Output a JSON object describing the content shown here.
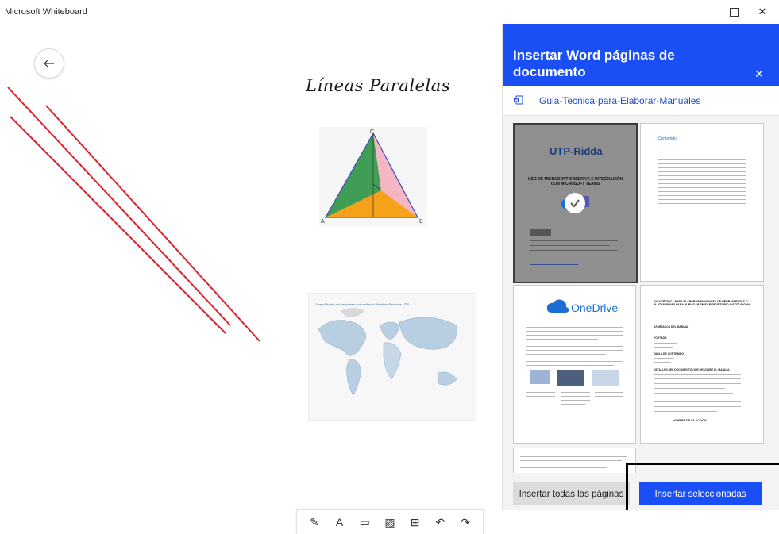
{
  "window": {
    "title": "Microsoft Whiteboard",
    "minimize": "–",
    "close": "✕"
  },
  "canvas": {
    "title": "Líneas Paralelas",
    "triangle_labels": {
      "a": "A",
      "b": "B",
      "c": "C"
    },
    "map_title": "Mapa Mundo del los países que visitan el Portal de Servicios UTP"
  },
  "toolbar": {
    "items": [
      {
        "name": "pen-icon",
        "glyph": "✎"
      },
      {
        "name": "text-icon",
        "glyph": "A"
      },
      {
        "name": "note-icon",
        "glyph": "▭"
      },
      {
        "name": "image-icon",
        "glyph": "▨"
      },
      {
        "name": "add-icon",
        "glyph": "⊞"
      },
      {
        "name": "undo-icon",
        "glyph": "↶"
      },
      {
        "name": "redo-icon",
        "glyph": "↷"
      }
    ]
  },
  "panel": {
    "title": "Insertar Word páginas de documento",
    "document_name": "Guia-Tecnica-para-Elaborar-Manuales",
    "pages": {
      "p1": {
        "logo": "UTP-Ridda",
        "heading": "USO DE MICROSOFT ONEDRIVE E INTEGRACIÓN CON MICROSOFT TEAMS"
      },
      "p2": {
        "heading": "Contenido"
      },
      "p3": {
        "logo": "OneDrive"
      },
      "p4": {
        "heading": "GUÍA TÉCNICA PARA ELABORAR MANUALES DE HERRAMIENTAS O PLATAFORMAS PARA PUBLICAR EN EL REPOSITORIO INSTITUCIONAL",
        "sections": [
          "APARTADOS DEL MANUAL",
          "PORTADA",
          "TABLA DE CONTENIDO",
          "DETALLES DEL DOCUMENTO QUE DESCRIBE EL MANUAL"
        ],
        "footer": "NOMBRE DE LA ACCIÓN"
      }
    },
    "buttons": {
      "insert_all": "Insertar todas las páginas",
      "insert_selected": "Insertar seleccionadas"
    }
  },
  "colors": {
    "accent": "#1a4ff5",
    "ink": "#e0202c"
  }
}
